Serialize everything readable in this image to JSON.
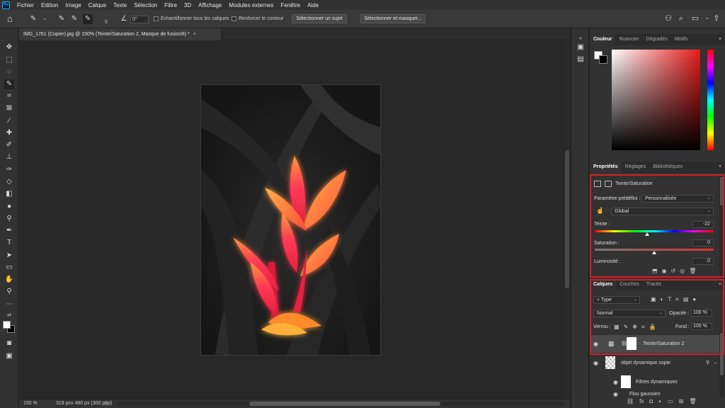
{
  "app": {
    "logo": "Ps",
    "menu": [
      "Fichier",
      "Edition",
      "Image",
      "Calque",
      "Texte",
      "Sélection",
      "Filtre",
      "3D",
      "Affichage",
      "Modules externes",
      "Fenêtre",
      "Aide"
    ]
  },
  "options": {
    "brush_size": "5",
    "angle": "0°",
    "sample_all_label": "Echantillonner tous les calques",
    "enhance_edge_label": "Renforcer le contour",
    "select_subject": "Sélectionner un sujet",
    "select_and_mask": "Sélectionner et masquer..."
  },
  "document": {
    "tab_title": "IMG_1761 (Copier).jpg @ 150% (Teinte/Saturation 2, Masque de fusion/8) *",
    "close": "×",
    "zoom": "150 %",
    "dimensions": "319 pcx 480 px (300 ppp)",
    "status_arrow": "›"
  },
  "color_panel": {
    "tabs": [
      "Couleur",
      "Nuancier",
      "Dégradés",
      "Motifs"
    ]
  },
  "properties_panel": {
    "tabs": [
      "Propriétés",
      "Réglages",
      "Bibliothèques"
    ],
    "title": "Teinte/Saturation",
    "preset_label": "Paramètre prédéfini :",
    "preset_value": "Personnalisée",
    "channel_value": "Global",
    "hue_label": "Teinte :",
    "hue_value": "-22",
    "hue_position": 0.44,
    "saturation_label": "Saturation :",
    "saturation_value": "0",
    "saturation_position": 0.5,
    "lightness_label": "Luminosité :",
    "lightness_value": "0"
  },
  "layers_panel": {
    "tabs": [
      "Calques",
      "Couches",
      "Tracés"
    ],
    "filter_value": "Type",
    "blend_mode": "Normal",
    "opacity_label": "Opacité :",
    "opacity_value": "100 %",
    "lock_label": "Verrou :",
    "fill_label": "Fond :",
    "fill_value": "100 %",
    "layers": [
      {
        "name": "Teinte/Saturation 2",
        "selected": true
      },
      {
        "name": "objet dynamique copie",
        "selected": false
      },
      {
        "name": "Filtres dynamiques",
        "selected": false
      },
      {
        "name": "Flou gaussien",
        "selected": false
      }
    ]
  },
  "colors": {
    "highlight_box": "#d0202a",
    "panel_bg": "#323232",
    "workspace_bg": "#282828"
  }
}
